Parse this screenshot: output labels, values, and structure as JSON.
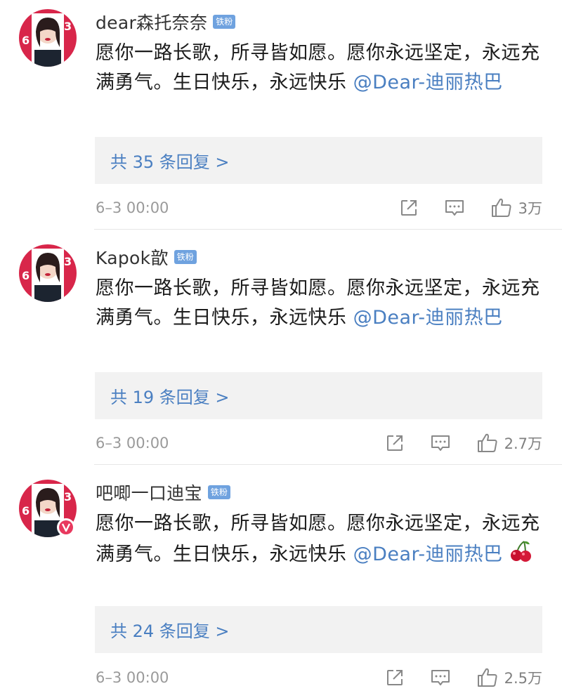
{
  "comments": [
    {
      "username": "dear森托奈奈",
      "badge": "铁粉",
      "text": "愿你一路长歌，所寻皆如愿。愿你永远坚定，永远充满勇气。生日快乐，永远快乐 ",
      "mention": "@Dear-迪丽热巴",
      "emoji": "",
      "replies_label": "共 35 条回复 >",
      "timestamp": "6–3 00:00",
      "likes": "3万",
      "vip": false
    },
    {
      "username": "Kapok歆",
      "badge": "铁粉",
      "text": "愿你一路长歌，所寻皆如愿。愿你永远坚定，永远充满勇气。生日快乐，永远快乐 ",
      "mention": "@Dear-迪丽热巴",
      "emoji": "",
      "replies_label": "共 19 条回复 >",
      "timestamp": "6–3 00:00",
      "likes": "2.7万",
      "vip": false
    },
    {
      "username": "吧唧一口迪宝",
      "badge": "铁粉",
      "text": "愿你一路长歌，所寻皆如愿。愿你永远坚定，永远充满勇气。生日快乐，永远快乐 ",
      "mention": "@Dear-迪丽热巴",
      "emoji": "cherry",
      "replies_label": "共 24 条回复 >",
      "timestamp": "6–3 00:00",
      "likes": "2.5万",
      "vip": true
    }
  ],
  "colors": {
    "link": "#4a7fc1",
    "badge": "#6fa2df",
    "reply_bg": "#f2f2f2",
    "meta_text": "#9a9a9a",
    "avatar_accent": "#d8264a"
  },
  "icons": {
    "share": "share-icon",
    "reply": "comment-icon",
    "like": "thumbs-up-icon",
    "vip": "vip-badge-icon",
    "cherry": "cherry-emoji"
  }
}
